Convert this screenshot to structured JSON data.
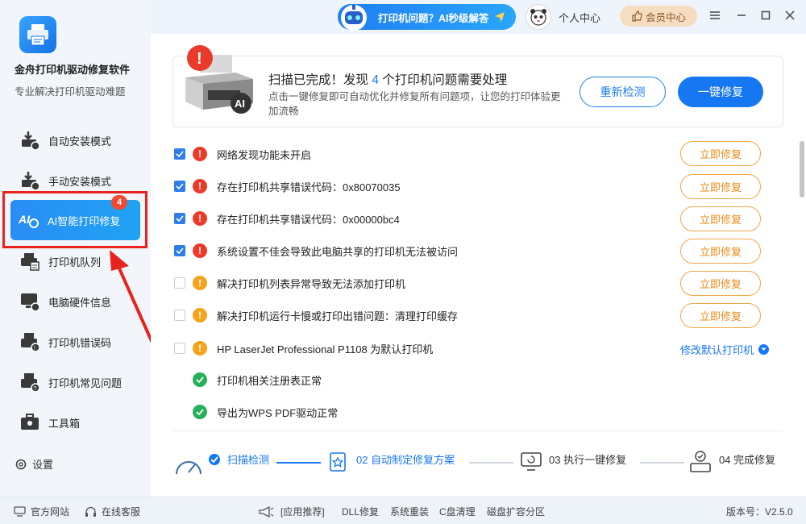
{
  "app": {
    "title": "金舟打印机驱动修复软件",
    "subtitle": "专业解决打印机驱动难题"
  },
  "sidebar": {
    "items": [
      {
        "label": "自动安装模式",
        "icon": "printer-auto-install-icon"
      },
      {
        "label": "手动安装模式",
        "icon": "printer-manual-install-icon"
      },
      {
        "label": "AI智能打印修复",
        "icon": "ai-repair-icon",
        "badge": "4"
      },
      {
        "label": "打印机队列",
        "icon": "printer-queue-icon"
      },
      {
        "label": "电脑硬件信息",
        "icon": "hardware-info-icon"
      },
      {
        "label": "打印机错误码",
        "icon": "error-code-icon"
      },
      {
        "label": "打印机常见问题",
        "icon": "faq-icon"
      },
      {
        "label": "工具箱",
        "icon": "toolbox-icon"
      }
    ],
    "settings_label": "设置"
  },
  "topbar": {
    "help_label": "打印机问题？AI秒级解答",
    "user_center_label": "个人中心",
    "vip_label": "会员中心"
  },
  "scan": {
    "title_prefix": "扫描已完成！发现",
    "count": "4",
    "title_suffix": "个打印机问题需要处理",
    "desc": "点击一键修复即可自动优化并修复所有问题项，让您的打印体验更加流畅",
    "rescan_label": "重新检测",
    "fixall_label": "一键修复"
  },
  "issues": [
    {
      "text": "网络发现功能未开启",
      "checked": true,
      "severity": "red",
      "action": "立即修复"
    },
    {
      "text": "存在打印机共享错误代码：0x80070035",
      "checked": true,
      "severity": "red",
      "action": "立即修复"
    },
    {
      "text": "存在打印机共享错误代码：0x00000bc4",
      "checked": true,
      "severity": "red",
      "action": "立即修复"
    },
    {
      "text": "系统设置不佳会导致此电脑共享的打印机无法被访问",
      "checked": true,
      "severity": "red",
      "action": "立即修复"
    },
    {
      "text": "解决打印机列表异常导致无法添加打印机",
      "checked": false,
      "severity": "orange",
      "action": "立即修复"
    },
    {
      "text": "解决打印机运行卡慢或打印出错问题：清理打印缓存",
      "checked": false,
      "severity": "orange",
      "action": "立即修复"
    },
    {
      "text": "HP LaserJet Professional P1108 为默认打印机",
      "checked": false,
      "severity": "orange",
      "action": "修改默认打印机"
    }
  ],
  "ok_items": [
    {
      "text": "打印机相关注册表正常"
    },
    {
      "text": "导出为WPS PDF驱动正常"
    }
  ],
  "steps": [
    {
      "label": "扫描检测",
      "state": "done"
    },
    {
      "label": "02 自动制定修复方案",
      "state": "current"
    },
    {
      "label": "03 执行一键修复",
      "state": "pending"
    },
    {
      "label": "04 完成修复",
      "state": "pending"
    }
  ],
  "footer": {
    "official_site": "官方网站",
    "online_service": "在线客服",
    "recommend": "[应用推荐]",
    "links": [
      "DLL修复",
      "系统重装",
      "C盘清理",
      "磁盘扩容分区"
    ],
    "version": "版本号：V2.5.0"
  },
  "colors": {
    "primary": "#1677f2",
    "danger": "#ea3b2a",
    "warning": "#f5a21c",
    "success": "#27b05a",
    "annotation_red": "#e8221d"
  }
}
